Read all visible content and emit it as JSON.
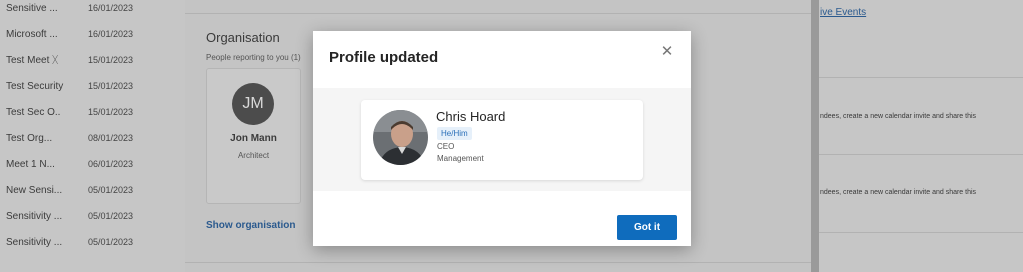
{
  "email_list": [
    {
      "subject": "Sensitive ...",
      "date": "16/01/2023"
    },
    {
      "subject": "Microsoft ...",
      "date": "16/01/2023"
    },
    {
      "subject": "Test Meet  ᚷ",
      "date": "15/01/2023"
    },
    {
      "subject": "Test Security",
      "date": "15/01/2023"
    },
    {
      "subject": "Test Sec  O..",
      "date": "15/01/2023"
    },
    {
      "subject": "Test   Org...",
      "date": "08/01/2023"
    },
    {
      "subject": "Meet 1   N...",
      "date": "06/01/2023"
    },
    {
      "subject": "New Sensi...",
      "date": "05/01/2023"
    },
    {
      "subject": "Sensitivity ...",
      "date": "05/01/2023"
    },
    {
      "subject": "Sensitivity ...",
      "date": "05/01/2023"
    }
  ],
  "organisation": {
    "title": "Organisation",
    "subtitle": "People reporting to you (1)",
    "report": {
      "initials": "JM",
      "name": "Jon Mann",
      "role": "Architect"
    },
    "show_link": "Show organisation"
  },
  "right_pane": {
    "live_events_link": "ive Events",
    "text_1": "ndees, create a new calendar invite and share this",
    "text_2": "ndees, create a new calendar invite and share this"
  },
  "modal": {
    "title": "Profile updated",
    "close_icon": "close-icon",
    "profile": {
      "name": "Chris Hoard",
      "pronouns": "He/Him",
      "job_title": "CEO",
      "department": "Management"
    },
    "confirm_label": "Got it"
  },
  "colors": {
    "primary_button": "#0f6cbd",
    "pronoun_badge_bg": "#e6f0fa",
    "pronoun_badge_text": "#2a6fb8"
  }
}
